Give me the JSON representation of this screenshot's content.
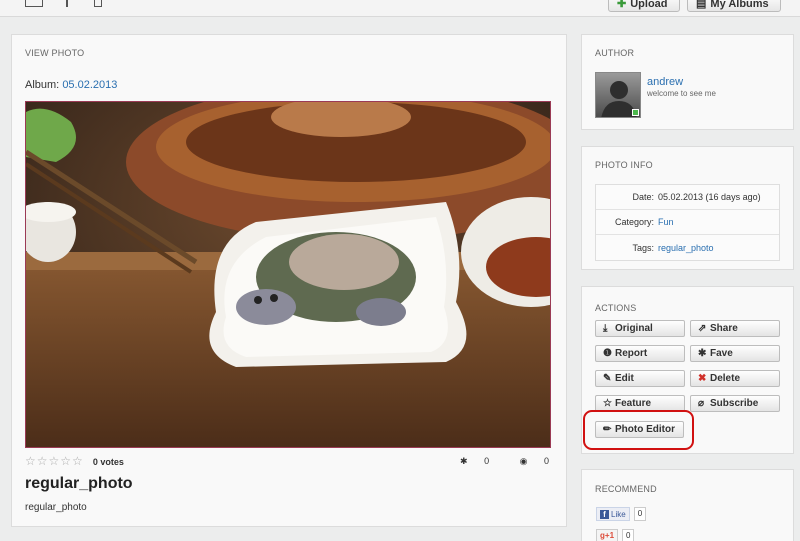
{
  "topbar": {
    "upload_label": "Upload",
    "my_albums_label": "My Albums"
  },
  "view_photo": {
    "section_title": "VIEW PHOTO",
    "album_label": "Album:",
    "album_name": "05.02.2013",
    "photo_alt": "regular_photo",
    "rating_stars": "☆☆☆☆☆",
    "votes": "0 votes",
    "favorites_count": "0",
    "views_count": "0",
    "title": "regular_photo",
    "description": "regular_photo"
  },
  "author": {
    "section_title": "AUTHOR",
    "name": "andrew",
    "tagline": "welcome to see me",
    "status_color": "#4cb84c"
  },
  "photo_info": {
    "section_title": "PHOTO INFO",
    "rows": [
      {
        "label": "Date:",
        "value": "05.02.2013 (16 days ago)"
      },
      {
        "label": "Category:",
        "value": "Fun"
      },
      {
        "label": "Tags:",
        "value": "regular_photo"
      }
    ]
  },
  "actions": {
    "section_title": "ACTIONS",
    "original": "Original",
    "share": "Share",
    "report": "Report",
    "fave": "Fave",
    "edit": "Edit",
    "delete": "Delete",
    "feature": "Feature",
    "subscribe": "Subscribe",
    "photo_editor": "Photo Editor",
    "highlight_color": "#d11111"
  },
  "recommend": {
    "section_title": "RECOMMEND",
    "fb_like_label": "Like",
    "fb_like_count": "0",
    "gplus_label": "+1",
    "gplus_count": "0"
  }
}
